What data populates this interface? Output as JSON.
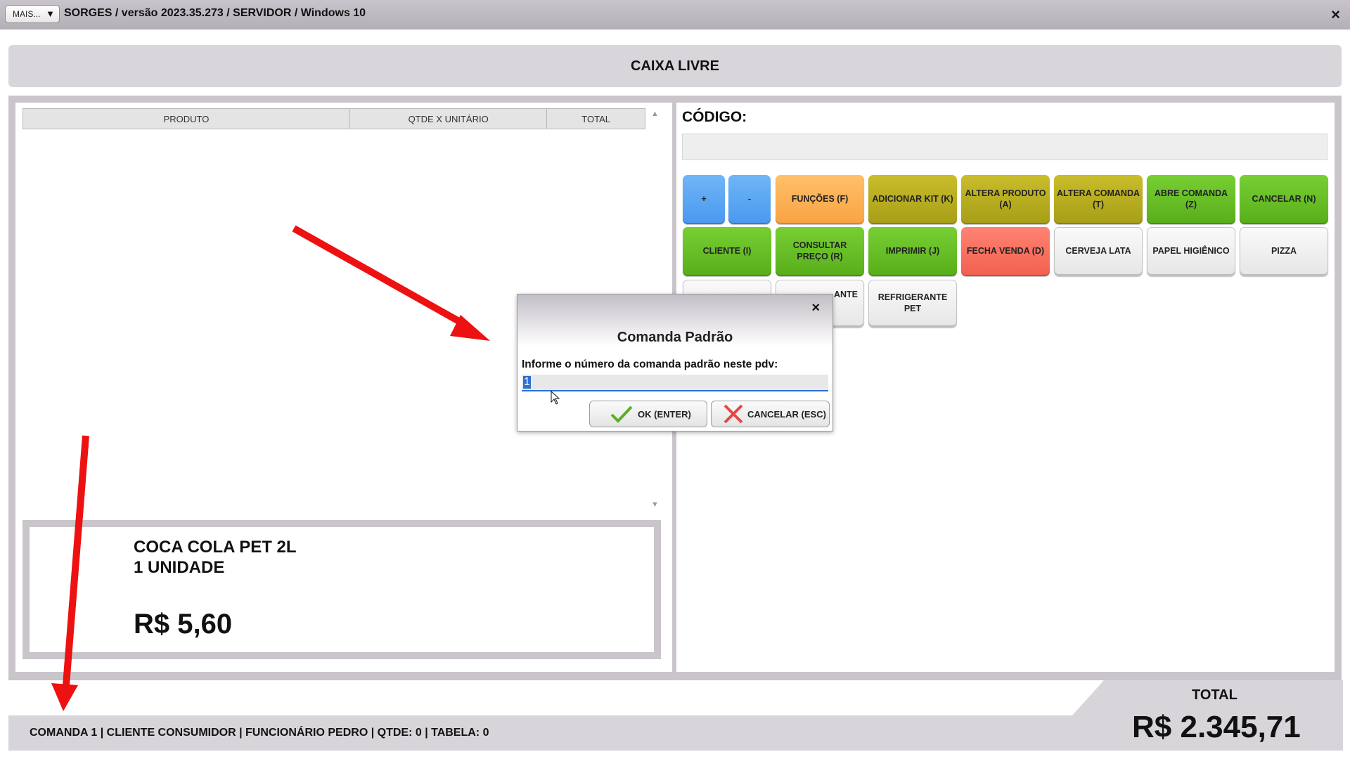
{
  "window": {
    "menu_button": "MAIS...",
    "title": "SORGES / versão 2023.35.273 / SERVIDOR / Windows 10",
    "close": "×"
  },
  "banner": "CAIXA LIVRE",
  "table": {
    "columns": [
      "PRODUTO",
      "QTDE X UNITÁRIO",
      "TOTAL"
    ],
    "rows": []
  },
  "product": {
    "name": "COCA COLA PET 2L",
    "quantity": "1 UNIDADE",
    "price": "R$ 5,60"
  },
  "codigo": {
    "label": "CÓDIGO:",
    "value": ""
  },
  "buttons": [
    {
      "label": "+",
      "color": "#5aa8f5"
    },
    {
      "label": "-",
      "color": "#5aa8f5"
    },
    {
      "label": "FUNÇÕES (F)",
      "color": "#fbb354"
    },
    {
      "label": "ADICIONAR KIT (K)",
      "color": "#b8ad20"
    },
    {
      "label": "ALTERA PRODUTO (A)",
      "color": "#b8ad20"
    },
    {
      "label": "ALTERA COMANDA (T)",
      "color": "#b8ad20"
    },
    {
      "label": "ABRE COMANDA (Z)",
      "color": "#66bf24"
    },
    {
      "label": "CANCELAR (N)",
      "color": "#66bf24"
    },
    {
      "label": "CLIENTE (I)",
      "color": "#66bf24"
    },
    {
      "label": "CONSULTAR PREÇO (R)",
      "color": "#66bf24"
    },
    {
      "label": "IMPRIMIR (J)",
      "color": "#66bf24"
    },
    {
      "label": "FECHA VENDA (D)",
      "color": "#f96f5f"
    },
    {
      "label": "CERVEJA LATA",
      "color": "#eeeeee"
    },
    {
      "label": "PAPEL HIGIÊNICO",
      "color": "#eeeeee"
    },
    {
      "label": "PIZZA",
      "color": "#eeeeee"
    },
    {
      "label": "",
      "color": "#eeeeee"
    },
    {
      "label": "ANTE",
      "color": "#eeeeee"
    },
    {
      "label": "REFRIGERANTE PET",
      "color": "#eeeeee"
    }
  ],
  "dialog": {
    "close": "×",
    "title": "Comanda Padrão",
    "prompt": "Informe o número da comanda padrão neste pdv:",
    "input_value": "1",
    "ok_label": "OK (ENTER)",
    "cancel_label": "CANCELAR (ESC)"
  },
  "footer": {
    "status": "COMANDA 1 | CLIENTE CONSUMIDOR | FUNCIONÁRIO PEDRO | QTDE: 0 | TABELA: 0",
    "total_label": "TOTAL",
    "total_value": "R$ 2.345,71"
  },
  "icons": [
    "dropdown-arrow-icon",
    "close-icon",
    "scroll-up-icon",
    "scroll-down-icon",
    "checkmark-icon",
    "x-mark-icon",
    "mouse-cursor-icon",
    "annotation-arrow-icon"
  ]
}
